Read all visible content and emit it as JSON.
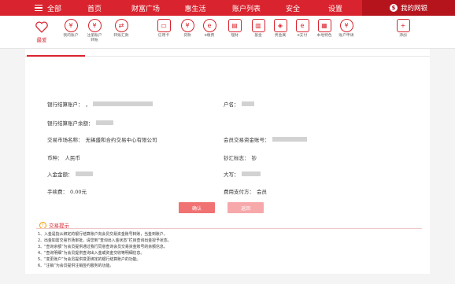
{
  "nav": {
    "all": "全部",
    "items": [
      "首页",
      "财富广场",
      "惠生活",
      "账户列表",
      "安全",
      "设置"
    ],
    "mine": "我的网银"
  },
  "toolbar": {
    "favorite": "最爱",
    "tools": [
      {
        "label": "我的账户",
        "icon": "yen-icon"
      },
      {
        "label": "注册账户 转账",
        "icon": "yen-transfer-icon"
      },
      {
        "label": "转账汇款",
        "icon": "transfer-icon"
      },
      {
        "label": "信用卡",
        "icon": "credit-card-icon"
      },
      {
        "label": "贷款",
        "icon": "loan-icon"
      },
      {
        "label": "e缴费",
        "icon": "pay-icon"
      },
      {
        "label": "理财",
        "icon": "finance-icon"
      },
      {
        "label": "基金",
        "icon": "fund-icon"
      },
      {
        "label": "贵金属",
        "icon": "gold-icon"
      },
      {
        "label": "e支付",
        "icon": "epay-icon"
      },
      {
        "label": "本地特色",
        "icon": "local-icon"
      },
      {
        "label": "账户申请",
        "icon": "apply-icon"
      },
      {
        "label": "添加",
        "icon": "plus-icon"
      }
    ]
  },
  "form": {
    "bank_account_label": "银行结算账户：",
    "bank_account_prefix": "，",
    "account_name_label": "户名：",
    "balance_label": "银行结算账户余额：",
    "market_label": "交易市场名称：",
    "market_value": "无锡盛和合约交易中心有限公司",
    "member_account_label": "会员交易资金账号：",
    "currency_label": "币种：",
    "currency_value": "人民币",
    "cash_flag_label": "钞汇标志：",
    "cash_flag_value": "钞",
    "deposit_label": "入金金额：",
    "uppercase_label": "大写：",
    "fee_label": "手续费：",
    "fee_value": "0.00元",
    "payer_label": "费用支付方：",
    "payer_value": "会员"
  },
  "buttons": {
    "confirm": "确认",
    "back": "返回"
  },
  "tips": {
    "title": "交易提示",
    "lines": [
      "1、入金是指从绑定的银行结算账户向会员交易资金账号转账，当金到账户。",
      "2、出金如需交易市场审批，请您到“查询出入金状态”栏目查询出金授予状态。",
      "3、“查询余额”为会员提供通过我行同意查询会员交易资金账号的余额信息。",
      "4、“查询明细”为会员提供查询出入金或资金交收等明细信息。",
      "5、“变更账户”为会员提供变更绑定的银行结算账户的功能。",
      "6、“注销”为会员提供注销签约服务的功能。"
    ]
  },
  "colors": {
    "brand_red": "#d9232e",
    "confirm_button": "#f07272",
    "back_button": "#f6a8aa"
  }
}
